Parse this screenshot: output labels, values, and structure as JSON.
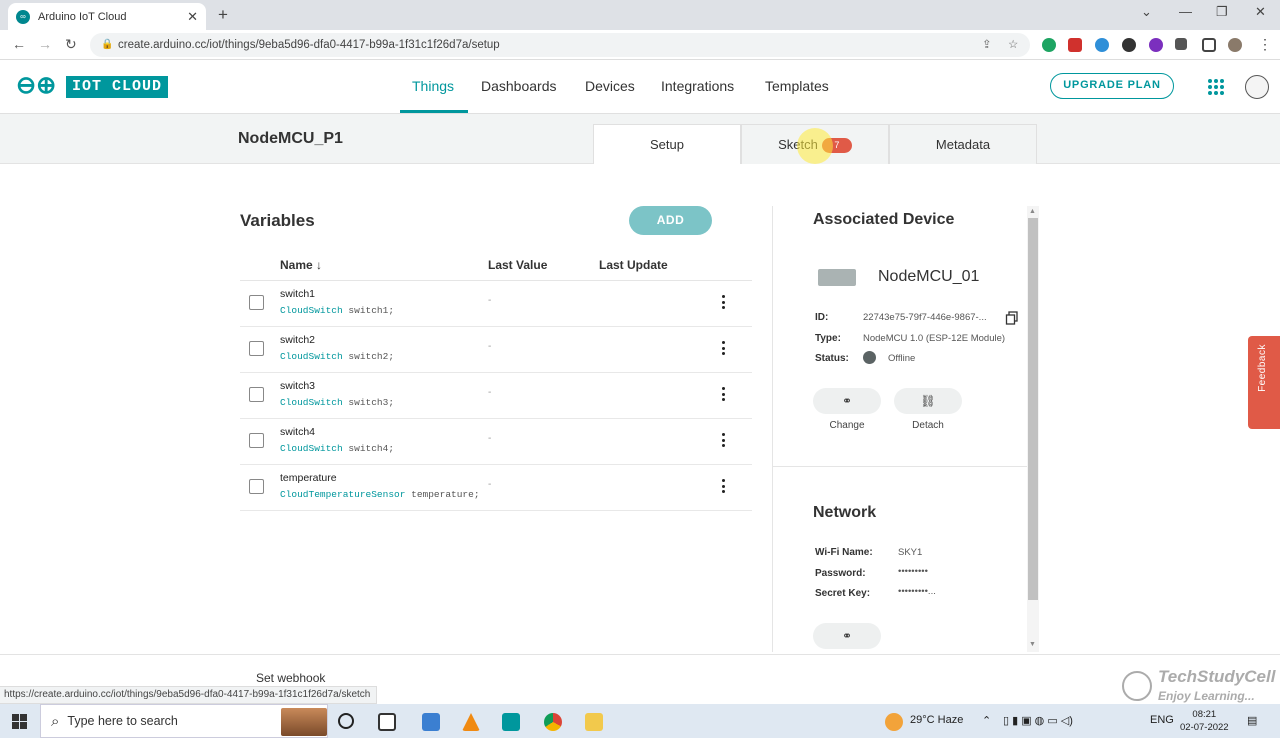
{
  "browser": {
    "tab_title": "Arduino IoT Cloud",
    "url": "create.arduino.cc/iot/things/9eba5d96-dfa0-4417-b99a-1f31c1f26d7a/setup",
    "status_url": "https://create.arduino.cc/iot/things/9eba5d96-dfa0-4417-b99a-1f31c1f26d7a/sketch"
  },
  "header": {
    "logo_text": "IOT CLOUD",
    "nav": [
      "Things",
      "Dashboards",
      "Devices",
      "Integrations",
      "Templates"
    ],
    "upgrade_label": "UPGRADE PLAN"
  },
  "thing": {
    "title": "NodeMCU_P1",
    "tabs": {
      "setup": "Setup",
      "sketch": "Sketch",
      "sketch_badge": "7",
      "metadata": "Metadata"
    }
  },
  "variables": {
    "title": "Variables",
    "add_label": "ADD",
    "columns": {
      "name": "Name",
      "sort_arrow": "↓",
      "last_value": "Last Value",
      "last_update": "Last Update"
    },
    "rows": [
      {
        "name": "switch1",
        "type": "CloudSwitch",
        "decl": "switch1;",
        "last_value": "-"
      },
      {
        "name": "switch2",
        "type": "CloudSwitch",
        "decl": "switch2;",
        "last_value": "-"
      },
      {
        "name": "switch3",
        "type": "CloudSwitch",
        "decl": "switch3;",
        "last_value": "-"
      },
      {
        "name": "switch4",
        "type": "CloudSwitch",
        "decl": "switch4;",
        "last_value": "-"
      },
      {
        "name": "temperature",
        "type": "CloudTemperatureSensor",
        "decl": "temperature;",
        "last_value": "-"
      }
    ]
  },
  "device": {
    "title": "Associated Device",
    "name": "NodeMCU_01",
    "id_label": "ID:",
    "id_value": "22743e75-79f7-446e-9867-...",
    "type_label": "Type:",
    "type_value": "NodeMCU 1.0 (ESP-12E Module)",
    "status_label": "Status:",
    "status_value": "Offline",
    "change_label": "Change",
    "detach_label": "Detach"
  },
  "network": {
    "title": "Network",
    "wifi_label": "Wi-Fi Name:",
    "wifi_value": "SKY1",
    "password_label": "Password:",
    "password_value": "•••••••••",
    "secret_label": "Secret Key:",
    "secret_value": "•••••••••..."
  },
  "footer": {
    "webhook": "Set webhook"
  },
  "feedback_label": "Feedback",
  "watermark": {
    "line1": "TechStudyCell",
    "line2": "Enjoy Learning..."
  },
  "taskbar": {
    "search_placeholder": "Type here to search",
    "weather": "29°C  Haze",
    "lang": "ENG",
    "time": "08:21",
    "date": "02-07-2022"
  },
  "colors": {
    "accent": "#00979d",
    "badge": "#e05a47",
    "status_offline": "#5b6364"
  }
}
